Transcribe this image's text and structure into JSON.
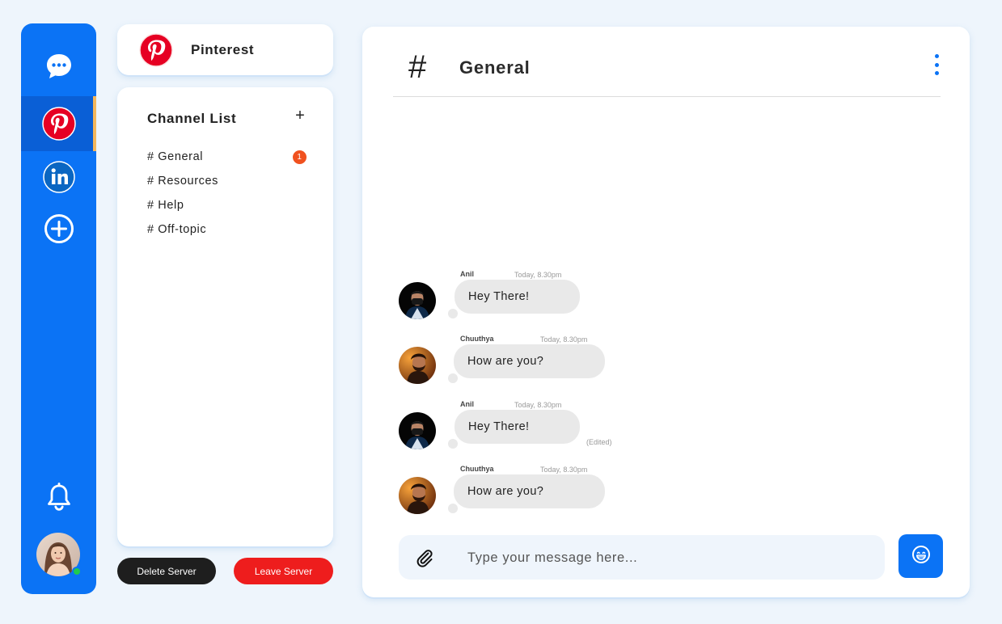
{
  "colors": {
    "accent": "#0b73f5",
    "accent_dark": "#0a5fd6",
    "active_indicator": "#f4b75c",
    "badge": "#f0511f",
    "leave": "#ee1d1d",
    "delete": "#1e1e1e",
    "bubble": "#e9e9e9",
    "online": "#1fcb4f"
  },
  "rail": {
    "items": [
      {
        "icon": "chat-bubble-icon"
      },
      {
        "icon": "pinterest-icon",
        "active": true
      },
      {
        "icon": "linkedin-icon"
      },
      {
        "icon": "add-circle-icon"
      }
    ],
    "bottom": [
      {
        "icon": "bell-icon"
      },
      {
        "icon": "user-avatar",
        "status": "online"
      }
    ]
  },
  "server": {
    "name": "Pinterest",
    "logo_icon": "pinterest-icon"
  },
  "channels": {
    "title": "Channel List",
    "add_label": "+",
    "items": [
      {
        "label": "# General",
        "badge": "1"
      },
      {
        "label": "# Resources"
      },
      {
        "label": "# Help"
      },
      {
        "label": "# Off-topic"
      }
    ]
  },
  "actions": {
    "delete_label": "Delete Server",
    "leave_label": "Leave Server"
  },
  "chat": {
    "hash": "#",
    "title": "General",
    "menu_icon": "kebab-menu-icon",
    "messages": [
      {
        "author": "Anil",
        "time": "Today, 8.30pm",
        "text": "Hey There!",
        "edited": ""
      },
      {
        "author": "Chuuthya",
        "time": "Today, 8.30pm",
        "text": "How are you?",
        "edited": ""
      },
      {
        "author": "Anil",
        "time": "Today, 8.30pm",
        "text": "Hey There!",
        "edited": "(Edited)"
      },
      {
        "author": "Chuuthya",
        "time": "Today, 8.30pm",
        "text": "How are you?",
        "edited": ""
      }
    ],
    "compose": {
      "placeholder": "Type your message here...",
      "attach_icon": "paperclip-icon",
      "emoji_icon": "emoji-icon"
    }
  }
}
